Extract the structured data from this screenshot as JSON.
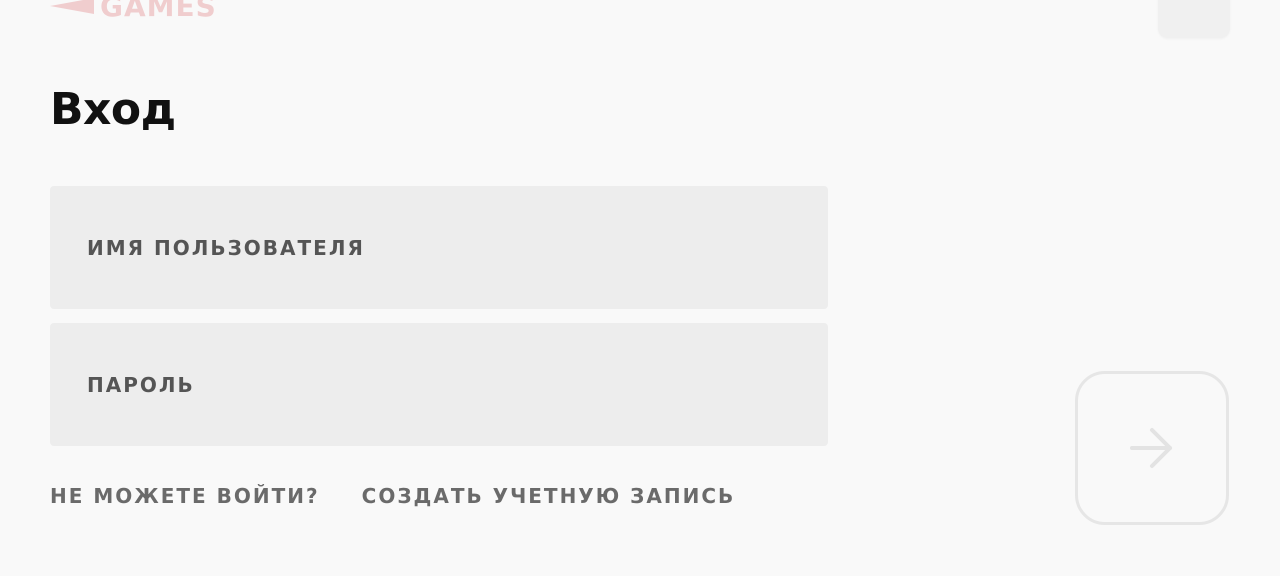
{
  "logo": {
    "text": "GAMES"
  },
  "login": {
    "title": "Вход",
    "username_label": "ИМЯ ПОЛЬЗОВАТЕЛЯ",
    "username_value": "",
    "password_label": "ПАРОЛЬ",
    "password_value": ""
  },
  "links": {
    "cant_sign_in": "НЕ МОЖЕТЕ ВОЙТИ?",
    "create_account": "СОЗДАТЬ УЧЕТНУЮ ЗАПИСЬ"
  },
  "submit": {
    "icon": "arrow-right-icon"
  },
  "colors": {
    "background": "#f9f9f9",
    "field_background": "#ededed",
    "brand_red": "#d13639",
    "label_gray": "#555555"
  }
}
